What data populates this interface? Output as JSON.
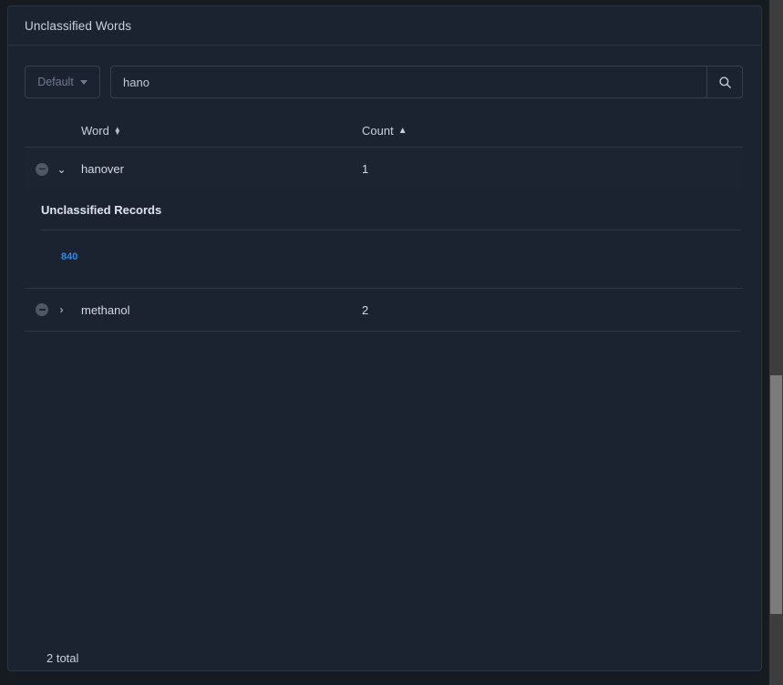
{
  "panel": {
    "title": "Unclassified Words"
  },
  "search": {
    "preset_label": "Default",
    "preset_icon": "caret-down-icon",
    "query_value": "hano",
    "query_placeholder": "",
    "search_icon": "search-icon"
  },
  "table": {
    "columns": [
      {
        "key": "word",
        "label": "Word",
        "sort_icon": "sort-both-icon",
        "sort_state": "none"
      },
      {
        "key": "count",
        "label": "Count",
        "sort_icon": "caret-up-icon",
        "sort_state": "asc"
      }
    ],
    "rows": [
      {
        "word": "hanover",
        "count": "1",
        "expanded": true,
        "remove_icon": "minus-circle-icon",
        "toggle_icon": "chevron-down-icon",
        "detail": {
          "title": "Unclassified Records",
          "value": "840"
        }
      },
      {
        "word": "methanol",
        "count": "2",
        "expanded": false,
        "remove_icon": "minus-circle-icon",
        "toggle_icon": "chevron-right-icon"
      }
    ]
  },
  "footer": {
    "total_label": "2 total"
  },
  "colors": {
    "page_background": "#161b22",
    "panel_background": "#1b2230",
    "panel_border": "#2c3545",
    "text_primary": "#c9d1d9",
    "text_muted": "#6e7b8c",
    "link_blue": "#2f8ae8",
    "row_selected": "#1c2432",
    "scrollbar_track": "#3d3d3d",
    "scrollbar_thumb": "#7b7b7b"
  }
}
